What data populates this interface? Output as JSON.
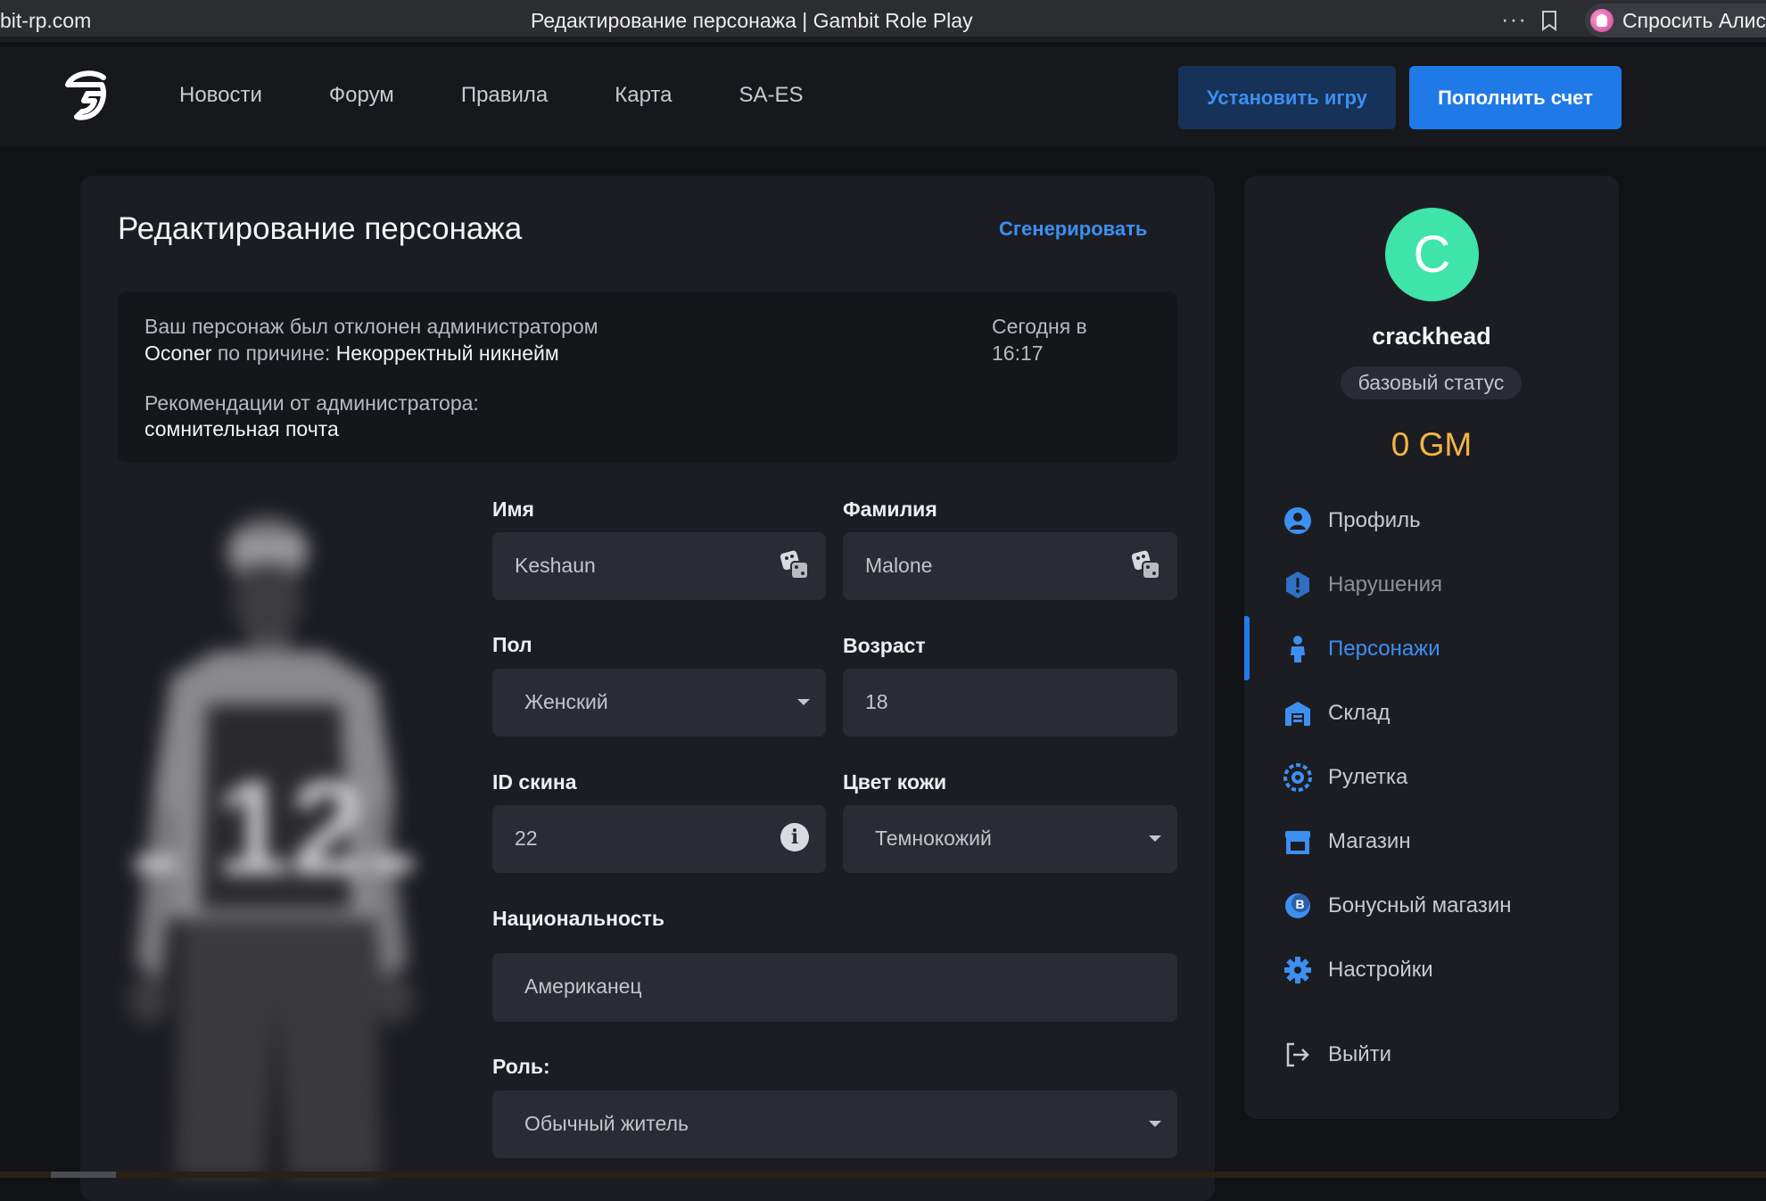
{
  "browser": {
    "url": "bit-rp.com",
    "tab_title": "Редактирование персонажа | Gambit Role Play",
    "menu_dots": "···",
    "alice_label": "Спросить Алису"
  },
  "header": {
    "nav": [
      "Новости",
      "Форум",
      "Правила",
      "Карта",
      "SA-ES"
    ],
    "install_label": "Установить игру",
    "topup_label": "Пополнить счет"
  },
  "editor": {
    "title": "Редактирование персонажа",
    "generate_label": "Сгенерировать",
    "notice": {
      "line1_prefix": "Ваш персонаж был отклонен администратором",
      "admin_name": "Oconer",
      "reason_prefix": "по причине:",
      "reason": "Некорректный никнейм",
      "recommendation_label": "Рекомендации от администратора:",
      "recommendation": "сомнительная почта",
      "time": "Сегодня в 16:17"
    },
    "form": {
      "first_name_label": "Имя",
      "first_name": "Keshaun",
      "last_name_label": "Фамилия",
      "last_name": "Malone",
      "gender_label": "Пол",
      "gender": "Женский",
      "age_label": "Возраст",
      "age": "18",
      "skin_id_label": "ID скина",
      "skin_id": "22",
      "skin_color_label": "Цвет кожи",
      "skin_color": "Темнокожий",
      "nationality_label": "Национальность",
      "nationality": "Американец",
      "role_label": "Роль:",
      "role": "Обычный житель"
    }
  },
  "profile": {
    "avatar_letter": "C",
    "avatar_color": "#3ee4a8",
    "username": "crackhead",
    "status": "базовый статус",
    "balance": "0 GM",
    "menu": [
      {
        "label": "Профиль",
        "icon": "user-icon"
      },
      {
        "label": "Нарушения",
        "icon": "warning-icon"
      },
      {
        "label": "Персонажи",
        "icon": "character-icon",
        "active": true
      },
      {
        "label": "Склад",
        "icon": "warehouse-icon"
      },
      {
        "label": "Рулетка",
        "icon": "roulette-icon"
      },
      {
        "label": "Магазин",
        "icon": "shop-icon"
      },
      {
        "label": "Бонусный магазин",
        "icon": "bonus-shop-icon"
      },
      {
        "label": "Настройки",
        "icon": "gear-icon"
      }
    ],
    "logout_label": "Выйти"
  },
  "colors": {
    "accent": "#1f7ae8",
    "accent_text": "#3d8ff0",
    "balance": "#f3b443",
    "background": "#111215",
    "card": "#1c1d22",
    "field": "#2a2c33"
  }
}
